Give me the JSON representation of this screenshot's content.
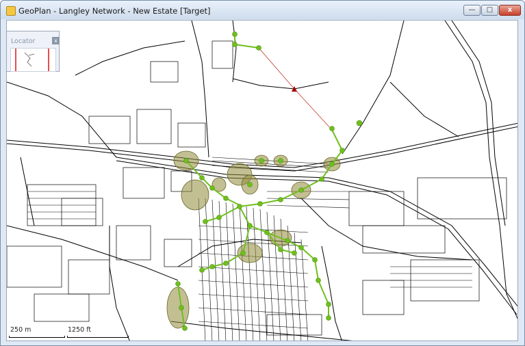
{
  "window": {
    "title": "GeoPlan - Langley Network - New Estate [Target]",
    "controls": {
      "minimize": "",
      "maximize": "",
      "close": "x"
    }
  },
  "locator": {
    "title": "Locator",
    "close_label": "x"
  },
  "scale_bar": {
    "metric_label": "250 m",
    "imperial_label": "1250 ft"
  },
  "colors": {
    "node_green": "#6fbf1e",
    "catchment_olive": "#8f8a3a",
    "pipe_red": "#c0392b",
    "marker_red": "#a30000",
    "road": "#000000"
  },
  "icons": [
    "app-icon",
    "minimize-icon",
    "maximize-icon",
    "close-icon",
    "target-marker-icon"
  ]
}
